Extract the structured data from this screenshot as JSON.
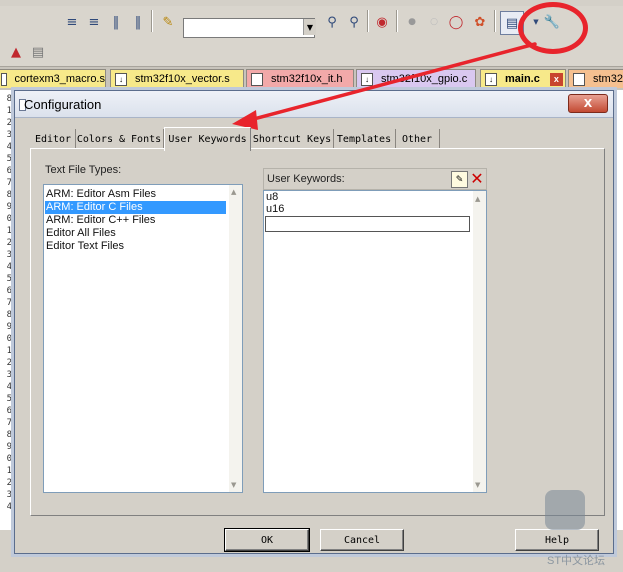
{
  "toolbar": {
    "combo_value": "",
    "buttons": [
      "indent-icon",
      "unindent-icon",
      "comment-icon",
      "uncomment-icon",
      "open-file-icon",
      "find-icon",
      "find-in-files-icon",
      "debug-icon",
      "breakpoint-icon",
      "breakpoint-disabled-icon",
      "clear-breakpoints-icon",
      "kill-breakpoints-icon",
      "window-layout-icon",
      "configuration-wrench-icon"
    ]
  },
  "file_tabs": [
    {
      "label": "cortexm3_macro.s",
      "color": "#f7e98a"
    },
    {
      "label": "stm32f10x_vector.s",
      "color": "#f7e98a"
    },
    {
      "label": "stm32f10x_it.h",
      "color": "#f2a9a9"
    },
    {
      "label": "stm32f10x_gpio.c",
      "color": "#d9c8f0"
    },
    {
      "label": "main.c",
      "color": "#f7e98a"
    },
    {
      "label": "stm32",
      "color": "#f5c090"
    }
  ],
  "gutter_lines": [
    "8",
    "1",
    "2",
    "3",
    "4",
    "5",
    "6",
    "7",
    "8",
    "9",
    "0",
    "1",
    "2",
    "3",
    "4",
    "5",
    "6",
    "7",
    "8",
    "9",
    "0",
    "1",
    "2",
    "3",
    "4",
    "5",
    "6",
    "7",
    "8",
    "9",
    "0",
    "1",
    "2",
    "3",
    "4"
  ],
  "dialog": {
    "title": "Configuration",
    "close_label": "X",
    "tabs": [
      "Editor",
      "Colors & Fonts",
      "User Keywords",
      "Shortcut Keys",
      "Templates",
      "Other"
    ],
    "active_tab": "User Keywords",
    "file_types_label": "Text File Types:",
    "file_types": [
      {
        "label": "ARM: Editor Asm Files",
        "selected": false
      },
      {
        "label": "ARM: Editor C Files",
        "selected": true
      },
      {
        "label": "ARM: Editor C++ Files",
        "selected": false
      },
      {
        "label": "Editor All Files",
        "selected": false
      },
      {
        "label": "Editor Text Files",
        "selected": false
      }
    ],
    "keywords_label": "User Keywords:",
    "keywords": [
      "u8",
      "u16"
    ],
    "new_keyword_value": "",
    "ok_label": "OK",
    "cancel_label": "Cancel",
    "help_label": "Help"
  },
  "watermark": {
    "text": "ST中文论坛"
  },
  "colors": {
    "annotation_red": "#e8242c",
    "selection_blue": "#3399ff"
  }
}
